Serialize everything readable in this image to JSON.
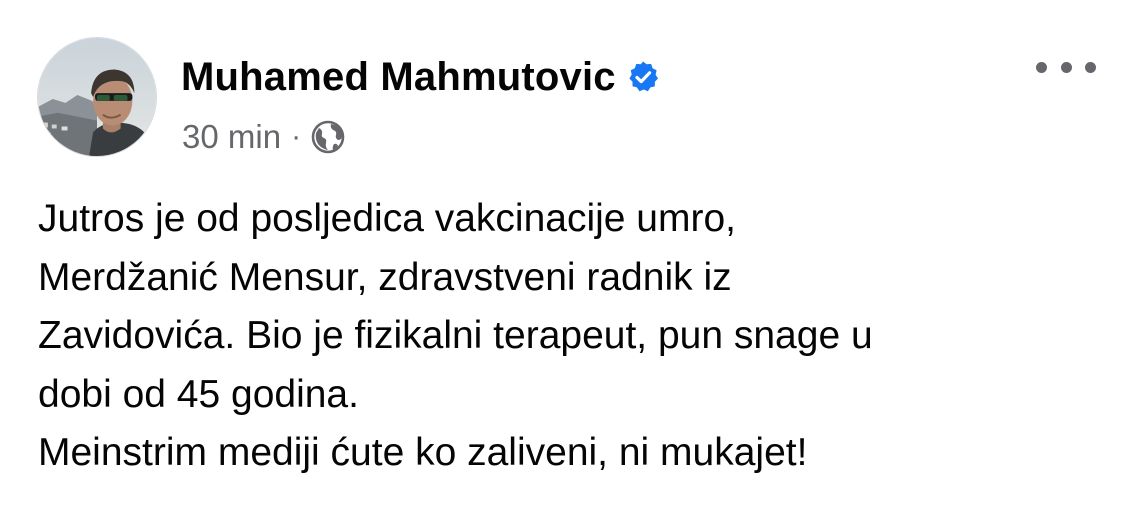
{
  "post": {
    "author": {
      "name": "Muhamed Mahmutovic",
      "verified": true,
      "avatar_icon": "profile-photo"
    },
    "meta": {
      "time": "30 min",
      "separator": "·",
      "audience_icon": "globe-icon"
    },
    "more_icon": "more-options-icon",
    "text_lines": [
      "Jutros je od posljedica vakcinacije umro,",
      "Merdžanić Mensur, zdravstveni radnik iz",
      "Zavidovića. Bio je fizikalni terapeut, pun snage u",
      "dobi od 45 godina.",
      "Meinstrim mediji ćute ko zaliveni, ni mukajet!"
    ]
  },
  "colors": {
    "text_primary": "#050505",
    "text_secondary": "#65676b",
    "verified_blue": "#1877f2",
    "background": "#ffffff"
  }
}
